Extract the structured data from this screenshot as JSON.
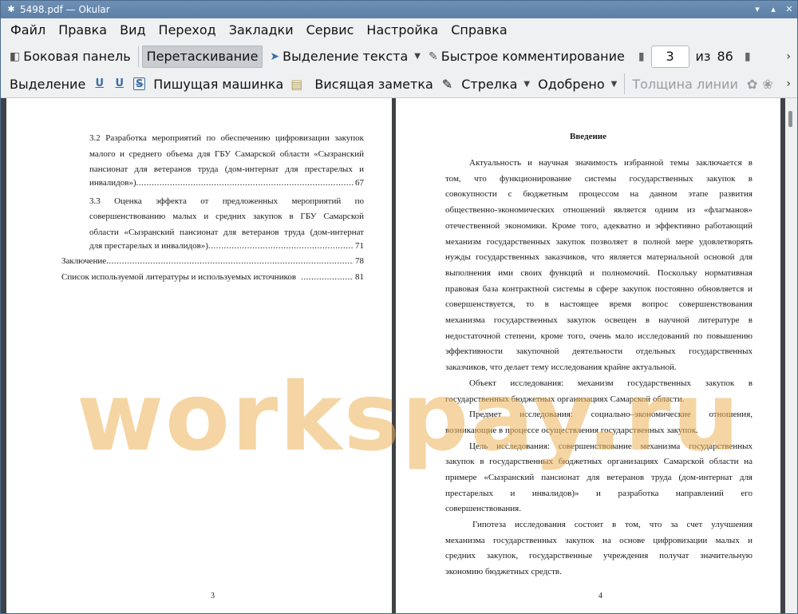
{
  "window": {
    "title": "5498.pdf  — Okular"
  },
  "menu": [
    "Файл",
    "Правка",
    "Вид",
    "Переход",
    "Закладки",
    "Сервис",
    "Настройка",
    "Справка"
  ],
  "toolbar1": {
    "sidebar": "Боковая панель",
    "drag": "Перетаскивание",
    "text_select": "Выделение текста",
    "quick_comment": "Быстрое комментирование",
    "page_current": "3",
    "page_of": "из",
    "page_total": "86"
  },
  "toolbar2": {
    "highlight": "Выделение",
    "typewriter": "Пишущая машинка",
    "note": "Висящая заметка",
    "arrow": "Стрелка",
    "approved": "Одобрено",
    "line_width": "Толщина линии"
  },
  "left_page": {
    "toc_32_lines": [
      "3.2 Разработка мероприятий по обеспечению цифровизации закупок",
      "малого и среднего объема для ГБУ Самарской области «Сызранский",
      "пансионат для ветеранов труда (дом-интернат для престарелых и"
    ],
    "toc_32_last": "инвалидов»)",
    "toc_32_page": "67",
    "toc_33_lines": [
      "3.3 Оценка эффекта от предложенных мероприятий по",
      "совершенствованию малых и средних закупок в ГБУ Самарской",
      "области «Сызранский пансионат для ветеранов труда (дом-интернат"
    ],
    "toc_33_last": "для престарелых и инвалидов»)",
    "toc_33_page": "71",
    "conclusion": "Заключение",
    "conclusion_page": "78",
    "references": "Список используемой литературы и используемых источников",
    "references_page": "81",
    "page_number": "3"
  },
  "right_page": {
    "heading": "Введение",
    "p1": [
      "Актуальность и научная значимость избранной темы заключается в",
      "том, что функционирование системы государственных закупок в",
      "совокупности с бюджетным процессом на данном этапе развития",
      "общественно-экономических отношений является одним из «флагманов»",
      "отечественной экономики. Кроме того, адекватно и эффективно работающий",
      "механизм государственных закупок позволяет в полной мере удовлетворять",
      "нужды государственных заказчиков, что является материальной основой для",
      "выполнения ими своих функций и полномочий. Поскольку нормативная",
      "правовая база контрактной системы в сфере закупок постоянно обновляется и",
      "совершенствуется, то в настоящее время вопрос совершенствования",
      "механизма государственных закупок освещен в научной литературе в",
      "недостаточной степени, кроме того, очень мало исследований по повышению",
      "эффективности закупочной деятельности отдельных государственных",
      "заказчиков, что делает тему исследования крайне актуальной."
    ],
    "p2": [
      "Объект исследования: механизм государственных закупок в",
      "государственных бюджетных организациях Самарской области."
    ],
    "p3": [
      "Предмет исследования: социально–экономические отношения,",
      "возникающие в процессе осуществления государственных закупок."
    ],
    "p4": [
      "Цель исследования: совершенствование механизма государственных",
      "закупок в государственных бюджетных организациях Самарской области на",
      "примере «Сызранский пансионат для ветеранов труда (дом-интернат для",
      "престарелых и инвалидов)» и разработка направлений его",
      "совершенствования."
    ],
    "p5": [
      "Гипотеза исследования состоит в том, что за счет улучшения",
      "механизма государственных закупок на основе цифровизации малых и",
      "средних закупок, государственные учреждения получат значительную",
      "экономию бюджетных средств."
    ],
    "page_number": "4"
  },
  "watermark": "workspay.ru"
}
